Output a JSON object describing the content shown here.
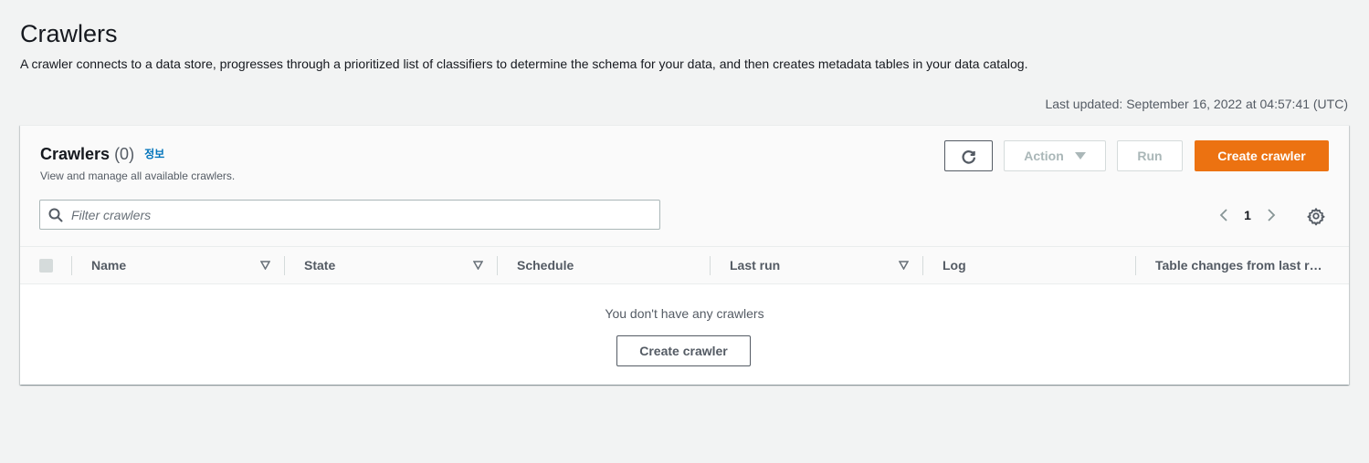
{
  "page": {
    "title": "Crawlers",
    "description": "A crawler connects to a data store, progresses through a prioritized list of classifiers to determine the schema for your data, and then creates metadata tables in your data catalog.",
    "last_updated": "Last updated: September 16, 2022 at 04:57:41 (UTC)"
  },
  "panel": {
    "title": "Crawlers",
    "count": "(0)",
    "info_label": "정보",
    "subtitle": "View and manage all available crawlers."
  },
  "toolbar": {
    "refresh_icon": "refresh-icon",
    "action_label": "Action",
    "run_label": "Run",
    "create_label": "Create crawler"
  },
  "search": {
    "placeholder": "Filter crawlers",
    "value": ""
  },
  "pagination": {
    "current_page": "1"
  },
  "table": {
    "columns": [
      {
        "label": "Name",
        "sortable": true
      },
      {
        "label": "State",
        "sortable": true
      },
      {
        "label": "Schedule",
        "sortable": false
      },
      {
        "label": "Last run",
        "sortable": true
      },
      {
        "label": "Log",
        "sortable": false
      },
      {
        "label": "Table changes from last r…",
        "sortable": false
      }
    ],
    "rows": [],
    "empty_message": "You don't have any crawlers",
    "empty_button_label": "Create crawler"
  },
  "colors": {
    "accent": "#ec7211",
    "link": "#0073bb",
    "background": "#f2f3f3"
  }
}
